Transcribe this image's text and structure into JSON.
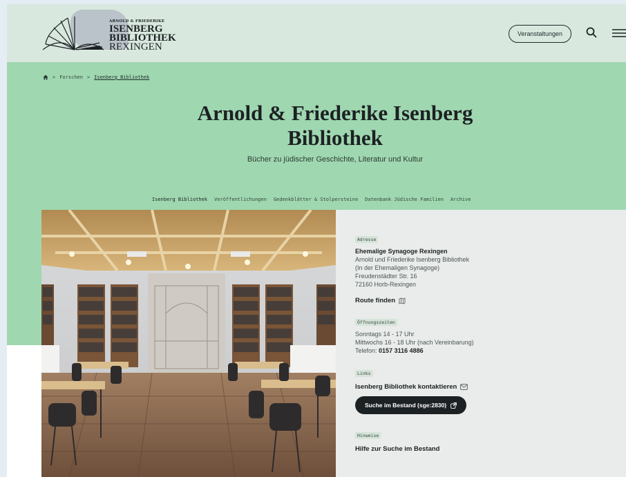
{
  "header": {
    "logo": {
      "small": "ARNOLD & FRIEDERIKE",
      "line1": "ISENBERG",
      "line2": "BIBLIOTHEK",
      "line3": "REXINGEN"
    },
    "events_label": "Veranstaltungen",
    "icons": [
      "search-icon",
      "menu-icon"
    ]
  },
  "breadcrumb": {
    "home_icon": "home-icon",
    "items": [
      "Forschen",
      "Isenberg Bibliothek"
    ],
    "separator": ">"
  },
  "hero": {
    "title_line1": "Arnold & Friederike Isenberg",
    "title_line2": "Bibliothek",
    "subtitle": "Bücher zu jüdischer Geschichte, Literatur und Kultur",
    "background": "#9fd7b0"
  },
  "tabs": [
    {
      "label": "Isenberg Bibliothek",
      "active": true
    },
    {
      "label": "Veröffentlichungen",
      "active": false
    },
    {
      "label": "Gedenkblätter & Stolpersteine",
      "active": false
    },
    {
      "label": "Datenbank Jüdische Familien",
      "active": false
    },
    {
      "label": "Archive",
      "active": false
    }
  ],
  "info": {
    "address_tag": "Adresse",
    "address_name": "Ehemalige Synagoge Rexingen",
    "address_lines": [
      "Arnold und Friederike Isenberg Bibliothek",
      "(In der Ehemaligen Synagoge)",
      "Freudenstädter Str. 16",
      "72160 Horb-Rexingen"
    ],
    "route_label": "Route finden",
    "hours_tag": "Öffnungszeiten",
    "hours_lines": [
      "Sonntags 14 - 17 Uhr",
      "Mittwochs 16 - 18 Uhr (nach Vereinbarung)"
    ],
    "phone_label": "Telefon:",
    "phone_number": "0157 3116 4886",
    "links_tag": "Links",
    "contact_label": "Isenberg Bibliothek kontaktieren",
    "search_button": "Suche im Bestand (sge:2830)",
    "notes_tag": "Hinweise",
    "help_label": "Hilfe zur Suche im Bestand"
  },
  "colors": {
    "accent_green": "#9fd7b0",
    "header_bg": "#d8e8de",
    "dark": "#1c2123",
    "panel_bg": "#e9ecea"
  }
}
